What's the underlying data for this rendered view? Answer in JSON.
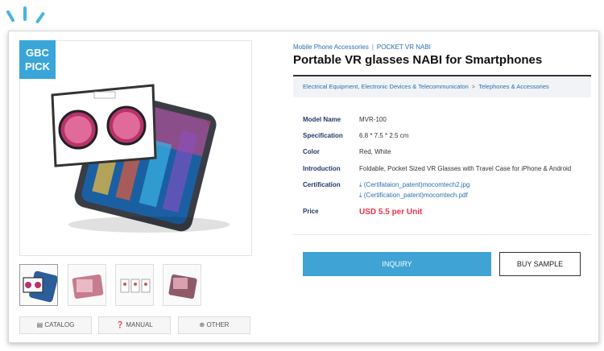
{
  "badge": {
    "line1": "GBC",
    "line2": "PICK"
  },
  "breadcrumb": {
    "parent": "Mobile Phone Accessories",
    "separator": "|",
    "current": "POCKET VR NABI"
  },
  "title": "Portable VR glasses NABI for Smartphones",
  "category": {
    "level1": "Electrical Equipment, Electronic Devices & Telecommunicaton",
    "arrow": ">",
    "level2": "Telephones & Accessories"
  },
  "specs": {
    "model": {
      "label": "Model Name",
      "value": "MVR-100"
    },
    "specification": {
      "label": "Specification",
      "value": "6.8 * 7.5 * 2.5 cm"
    },
    "color": {
      "label": "Color",
      "value": "Red, White"
    },
    "introduction": {
      "label": "Introduction",
      "value": "Foldable, Pocket Sized VR Glasses with Travel Case for iPhone & Android"
    },
    "certification": {
      "label": "Certification",
      "files": [
        "⤓ (Certifataion_patent)mocomtech2.jpg",
        "⤓ (Certification_patent)mocomtech.pdf"
      ]
    },
    "price": {
      "label": "Price",
      "value": "USD 5.5 per Unit"
    }
  },
  "actions": {
    "inquiry": "INQUIRY",
    "buy_sample": "BUY SAMPLE"
  },
  "docs": {
    "catalog": "▤ CATALOG",
    "manual": "❓ MANUAL",
    "other": "⊕ OTHER"
  },
  "colors": {
    "accent": "#3fa3d6",
    "price": "#e8344a",
    "label": "#1f3a6b",
    "link": "#2a6fb0"
  }
}
